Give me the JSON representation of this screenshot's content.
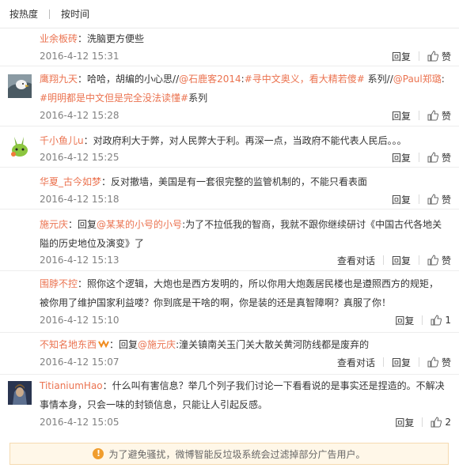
{
  "sort": {
    "by_hot": "按热度",
    "by_time": "按时间"
  },
  "labels": {
    "reply": "回复",
    "view_conversation": "查看对话"
  },
  "comments": [
    {
      "user": "业余板砖",
      "sep": "：",
      "text": "洗脑更方便些",
      "time": "2016-4-12 15:31",
      "likes": "赞"
    },
    {
      "user": "鹰翔九天",
      "sep": "：",
      "t1": "哈哈，胡编的小心思//",
      "m1": "@石鹿客2014",
      "t2": ":",
      "tag1": "#寻中文奥义，看大精若傻#",
      "t3": " 系列//",
      "m2": "@Paul郑璐",
      "t4": ":",
      "tag2": "#明明都是中文但是完全没法读懂#",
      "t5": "系列",
      "time": "2016-4-12 15:28",
      "likes": "赞"
    },
    {
      "user": "千小鱼儿u",
      "sep": "：",
      "text": "对政府利大于弊，对人民弊大于利。再深一点，当政府不能代表人民后。。。",
      "time": "2016-4-12 15:25",
      "likes": "赞"
    },
    {
      "user": "华夏_古今如梦",
      "sep": "：",
      "text": "反对撤墙，美国是有一套很完整的监管机制的，不能只看表面",
      "time": "2016-4-12 15:18",
      "likes": "赞"
    },
    {
      "user": "施元庆",
      "sep": "：",
      "t1": "回复",
      "m1": "@某某的小号的小号",
      "t2": ":为了不拉低我的智商，我就不跟你继续研讨《中国古代各地关隘的历史地位及演变》了",
      "time": "2016-4-12 15:13",
      "likes": "赞"
    },
    {
      "user": "围脖不控",
      "sep": "：",
      "text": "照你这个逻辑，大炮也是西方发明的，所以你用大炮轰居民楼也是遵照西方的规矩，被你用了维护国家利益喽？你到底是干啥的啊，你是装的还是真智障啊？真服了你！",
      "time": "2016-4-12 15:10",
      "likes": "1"
    },
    {
      "user": "不知名地东西",
      "sep": "：",
      "t1": "回复",
      "m1": "@施元庆",
      "t2": ":潼关镇南关玉门关大散关黄河防线都是废弃的",
      "time": "2016-4-12 15:07",
      "likes": "赞"
    },
    {
      "user": "TitianiumHao",
      "sep": "：",
      "text": "什么叫有害信息？举几个列子我们讨论一下看看说的是事实还是捏造的。不解决事情本身，只会一味的封锁信息，只能让人引起反感。",
      "time": "2016-4-12 15:05",
      "likes": "2"
    }
  ],
  "notice": "为了避免骚扰，微博智能反垃圾系统会过滤掉部分广告用户。",
  "colors": {
    "accent": "#eb7350",
    "notice_bg": "#fff7e8",
    "warn": "#f09d2d"
  }
}
